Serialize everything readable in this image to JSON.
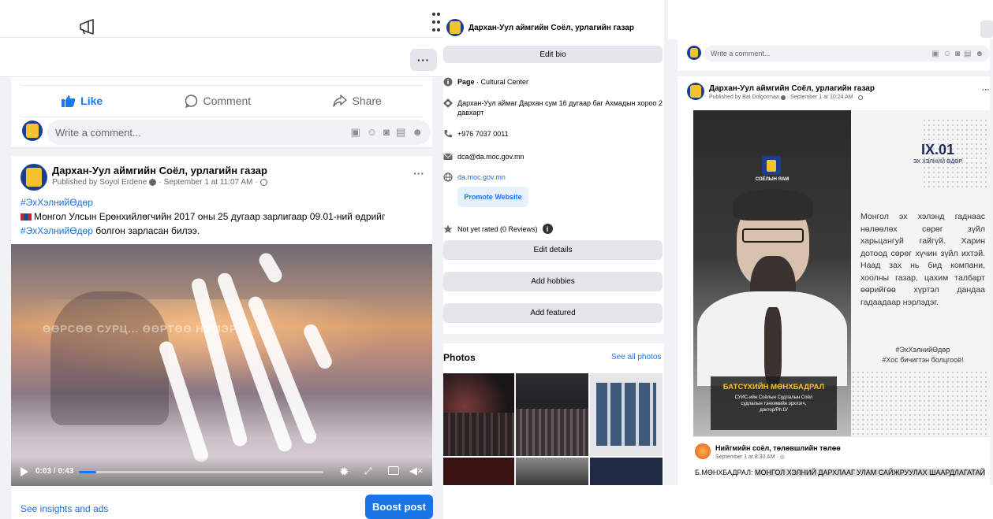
{
  "left": {
    "post_actions": {
      "like": "Like",
      "comment": "Comment",
      "share": "Share"
    },
    "comment_placeholder": "Write a comment...",
    "post": {
      "page_name": "Дархан-Уул аймгийн Соёл, урлагийн газар",
      "published_prefix": "Published by",
      "publisher": "Soyol Erdene",
      "date": "September 1 at 11:07 AM",
      "hashtag": "#ЭхХэлнийӨдөр",
      "body_line1": "Монгол Улсын Ерөнхийлөгчийн 2017 оны 25 дугаар зарлигаар 09.01-ний өдрийг",
      "body_hashtag": "#ЭхХэлнийӨдөр",
      "body_line2_rest": "болгон зарласан билээ.",
      "video_overlay_text": "ӨӨРСӨӨ СУРЦ... ӨӨРТӨӨ НЭМЭР",
      "video_time": "0:03 / 0:43",
      "video_progress": 0.07
    },
    "footer": {
      "insights": "See insights and ads",
      "boost": "Boost post"
    },
    "more_label": "···"
  },
  "middle": {
    "header_title": "Дархан-Уул аймгийн Соёл, урлагийн газар",
    "edit_bio": "Edit bio",
    "page_type_bold": "Page",
    "page_type_rest": " · Cultural Center",
    "address": "Дархан-Уул аймаг Дархан сум 16 дугаар баг Ахмадын хороо 2 давхарт",
    "phone": "+976 7037 0011",
    "email": "dca@da.moc.gov.mn",
    "website": "da.moc.gov.mn",
    "promote_website": "Promote Website",
    "rating": "Not yet rated (0 Reviews)",
    "edit_details": "Edit details",
    "add_hobbies": "Add hobbies",
    "add_featured": "Add featured",
    "photos_title": "Photos",
    "see_all_photos": "See all photos"
  },
  "right": {
    "comment_placeholder": "Write a comment...",
    "post": {
      "page_name": "Дархан-Уул аймгийн Соёл, урлагийн газар",
      "published_prefix": "Published by",
      "publisher": "Bat Dolgormaa",
      "date": "September 1 at 10:24 AM",
      "more_label": "···"
    },
    "poster": {
      "logo_caption": "СОЁЛЫН ЯАМ",
      "date_big": "IX.01",
      "date_sub": "ЭХ ХЭЛНИЙ ӨДӨР",
      "quote": "Монгол эх хэлэнд гаднаас нөлөөлөх сөрөг зүйл харьцангуй гайгүй. Харин дотоод сөрөг хүчин зүйл ихтэй. Наад зах нь бид компани, хоолны газар, цахим талбарт өөрийгөө хүртэл дандаа гадаадаар нэрлэдэг.",
      "hashtag1": "#ЭхХэлнийӨдөр",
      "hashtag2": "#Хос бичигтэн болцгооё!",
      "person_name": "БАТСҮХИЙН МӨНХБАДРАЛ",
      "person_title_1": "СУИС-ийн Соёлын Судлалын Соёл",
      "person_title_2": "судлалын тэнхимийн эрхлэгч,",
      "person_title_3": "доктор/Ph.D/"
    },
    "shared": {
      "name": "Нийгмийн соёл, төлөвшлийн төлөө",
      "date": "September 1 at 8:30 AM",
      "text_prefix": "Б.МӨНХБАДРАЛ: ",
      "text_highlight": "МОНГОЛ ХЭЛНИЙ ДАРХЛААГ УЛАМ САЙЖРУУЛАХ ШААРДЛАГАТАЙ"
    }
  },
  "colors": {
    "fb_blue": "#1877f2",
    "boost_blue": "#1b74e4",
    "hashtag": "#216fdb"
  }
}
